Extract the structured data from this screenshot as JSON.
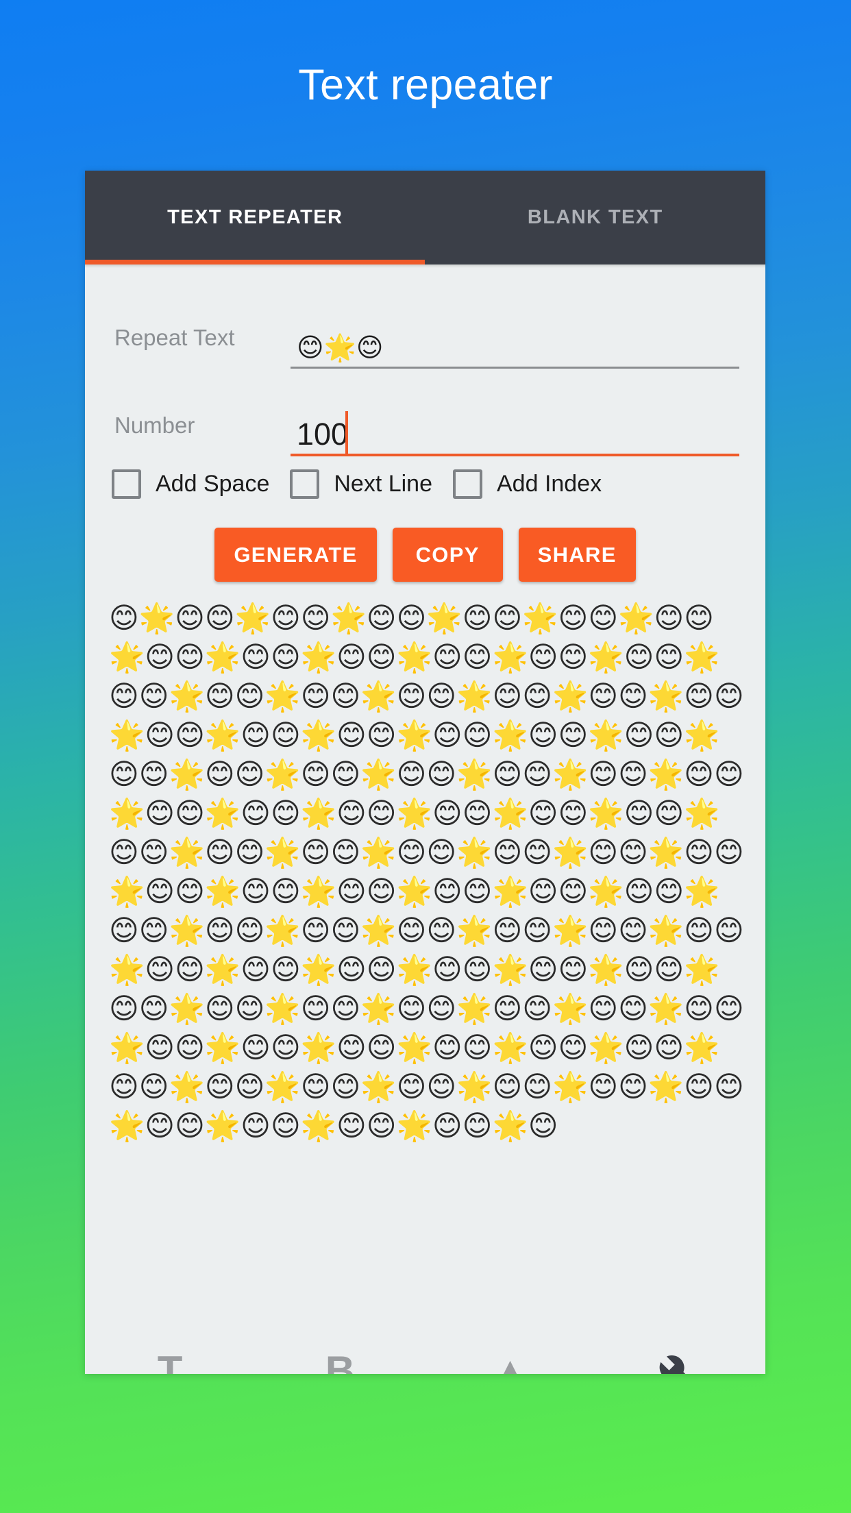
{
  "page": {
    "title": "Text repeater",
    "background_top_color": "#0f7ef2",
    "background_bottom_color": "#5bee4c"
  },
  "card": {
    "background_color": "#eceff0",
    "tabbar": {
      "background_color": "#3b3f48",
      "indicator_color": "#ef5a29",
      "tabs": [
        {
          "label": "TEXT REPEATER",
          "active": true
        },
        {
          "label": "BLANK TEXT",
          "active": false
        }
      ]
    },
    "form": {
      "fields": [
        {
          "label": "Repeat Text",
          "value": "😊🌟😊",
          "placeholder": "",
          "focused": false,
          "underline_color": "#8a8d90"
        },
        {
          "label": "Number",
          "value": "100",
          "placeholder": "",
          "focused": true,
          "underline_color": "#ef5a29"
        }
      ],
      "checkboxes": [
        {
          "label": "Add Space",
          "checked": false
        },
        {
          "label": "Next Line",
          "checked": false
        },
        {
          "label": "Add Index",
          "checked": false
        }
      ],
      "buttons": [
        {
          "label": "GENERATE",
          "color": "#f95b24"
        },
        {
          "label": "COPY",
          "color": "#f95b24"
        },
        {
          "label": "SHARE",
          "color": "#f95b24"
        }
      ]
    },
    "output": {
      "unit": "😊🌟😊",
      "repeat_count": 100,
      "text": "😊🌟😊😊🌟😊😊🌟😊😊🌟😊😊🌟😊😊🌟😊😊🌟😊😊🌟😊😊🌟😊😊🌟😊😊🌟😊😊🌟😊😊🌟😊😊🌟😊😊🌟😊😊🌟😊😊🌟😊😊🌟😊😊🌟😊😊🌟😊😊🌟😊😊🌟😊😊🌟😊😊🌟😊😊🌟😊😊🌟😊😊🌟😊😊🌟😊😊🌟😊😊🌟😊😊🌟😊😊🌟😊😊🌟😊😊🌟😊😊🌟😊😊🌟😊😊🌟😊😊🌟😊😊🌟😊😊🌟😊😊🌟😊😊🌟😊😊🌟😊😊🌟😊😊🌟😊😊🌟😊😊🌟😊😊🌟😊😊🌟😊😊🌟😊😊🌟😊😊🌟😊😊🌟😊😊🌟😊😊🌟😊😊🌟😊😊🌟😊😊🌟😊😊🌟😊😊🌟😊😊🌟😊😊🌟😊😊🌟😊😊🌟😊😊🌟😊😊🌟😊😊🌟😊😊🌟😊😊🌟😊😊🌟😊😊🌟😊😊🌟😊😊🌟😊😊🌟😊😊🌟😊😊🌟😊😊🌟😊😊🌟😊😊🌟😊😊🌟😊😊🌟😊😊🌟😊😊🌟😊😊🌟😊😊🌟😊😊🌟😊😊🌟😊😊🌟😊😊🌟😊"
    },
    "bottom_nav": [
      {
        "icon": "text-format-icon",
        "glyph": "T"
      },
      {
        "icon": "bold-text-icon",
        "glyph": "B"
      },
      {
        "icon": "edit-pencil-icon",
        "glyph": "▲"
      },
      {
        "icon": "wrench-icon",
        "glyph": ""
      }
    ]
  }
}
